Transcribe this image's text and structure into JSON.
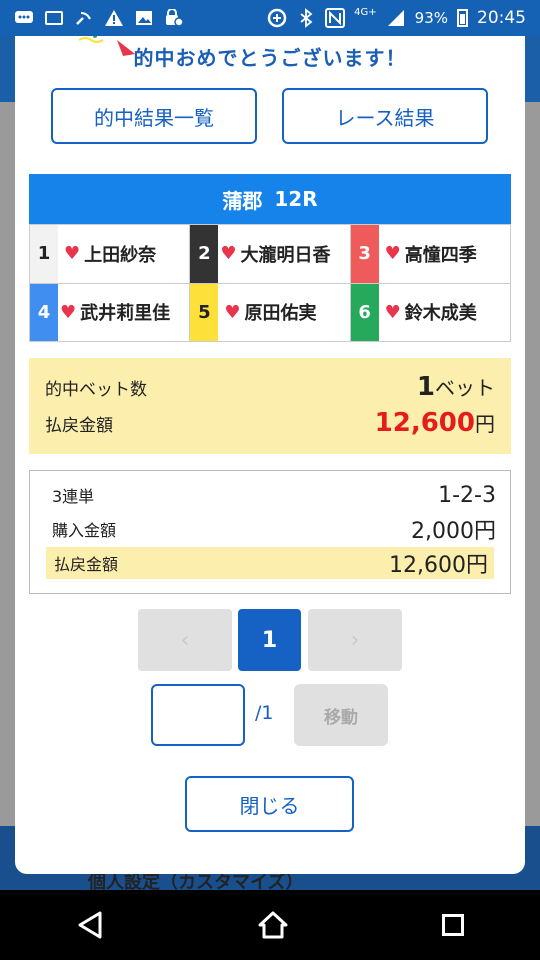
{
  "status_bar": {
    "time": "20:45",
    "battery": "93%",
    "network": "4G+",
    "icons": [
      "message-icon",
      "photo-icon",
      "wifi-call-icon",
      "warning-icon",
      "gallery-icon",
      "settings-lock-icon",
      "data-saver-icon",
      "bluetooth-icon",
      "nfc-icon",
      "signal-icon",
      "battery-icon"
    ]
  },
  "background": {
    "bottom_text": "個人設定（カスタマイズ）"
  },
  "modal": {
    "congrats_text": "的中おめでとうございます！",
    "buttons": {
      "hit_list": "的中結果一覧",
      "race_result": "レース結果"
    },
    "race": {
      "venue": "蒲郡",
      "race_no": "12R"
    },
    "racers": [
      {
        "num": "1",
        "name": "上田紗奈",
        "num_bg": "#f2f2f2",
        "num_color": "#222222"
      },
      {
        "num": "2",
        "name": "大瀧明日香",
        "num_bg": "#333333",
        "num_color": "#ffffff"
      },
      {
        "num": "3",
        "name": "高憧四季",
        "num_bg": "#ef5a5a",
        "num_color": "#ffffff"
      },
      {
        "num": "4",
        "name": "武井莉里佳",
        "num_bg": "#3f8ef0",
        "num_color": "#ffffff"
      },
      {
        "num": "5",
        "name": "原田佑実",
        "num_bg": "#fde03a",
        "num_color": "#222222"
      },
      {
        "num": "6",
        "name": "鈴木成美",
        "num_bg": "#27a95b",
        "num_color": "#ffffff"
      }
    ],
    "summary": {
      "hit_bets_label": "的中ベット数",
      "hit_bets_value": "1",
      "hit_bets_unit": "ベット",
      "payout_label": "払戻金額",
      "payout_value": "12,600",
      "payout_unit": "円"
    },
    "detail": {
      "bet_type": "3連単",
      "combination": "1-2-3",
      "purchase_label": "購入金額",
      "purchase_value": "2,000円",
      "payout_label": "払戻金額",
      "payout_value": "12,600円"
    },
    "pagination": {
      "prev": "‹",
      "current": "1",
      "next": "›",
      "input_value": "",
      "total": "/1",
      "move_label": "移動"
    },
    "close_label": "閉じる"
  },
  "colors": {
    "accent": "#1662c4",
    "race_header": "#1583e9",
    "highlight": "#fcefae",
    "payout_red": "#e61b1b",
    "heart": "#e8354b"
  }
}
